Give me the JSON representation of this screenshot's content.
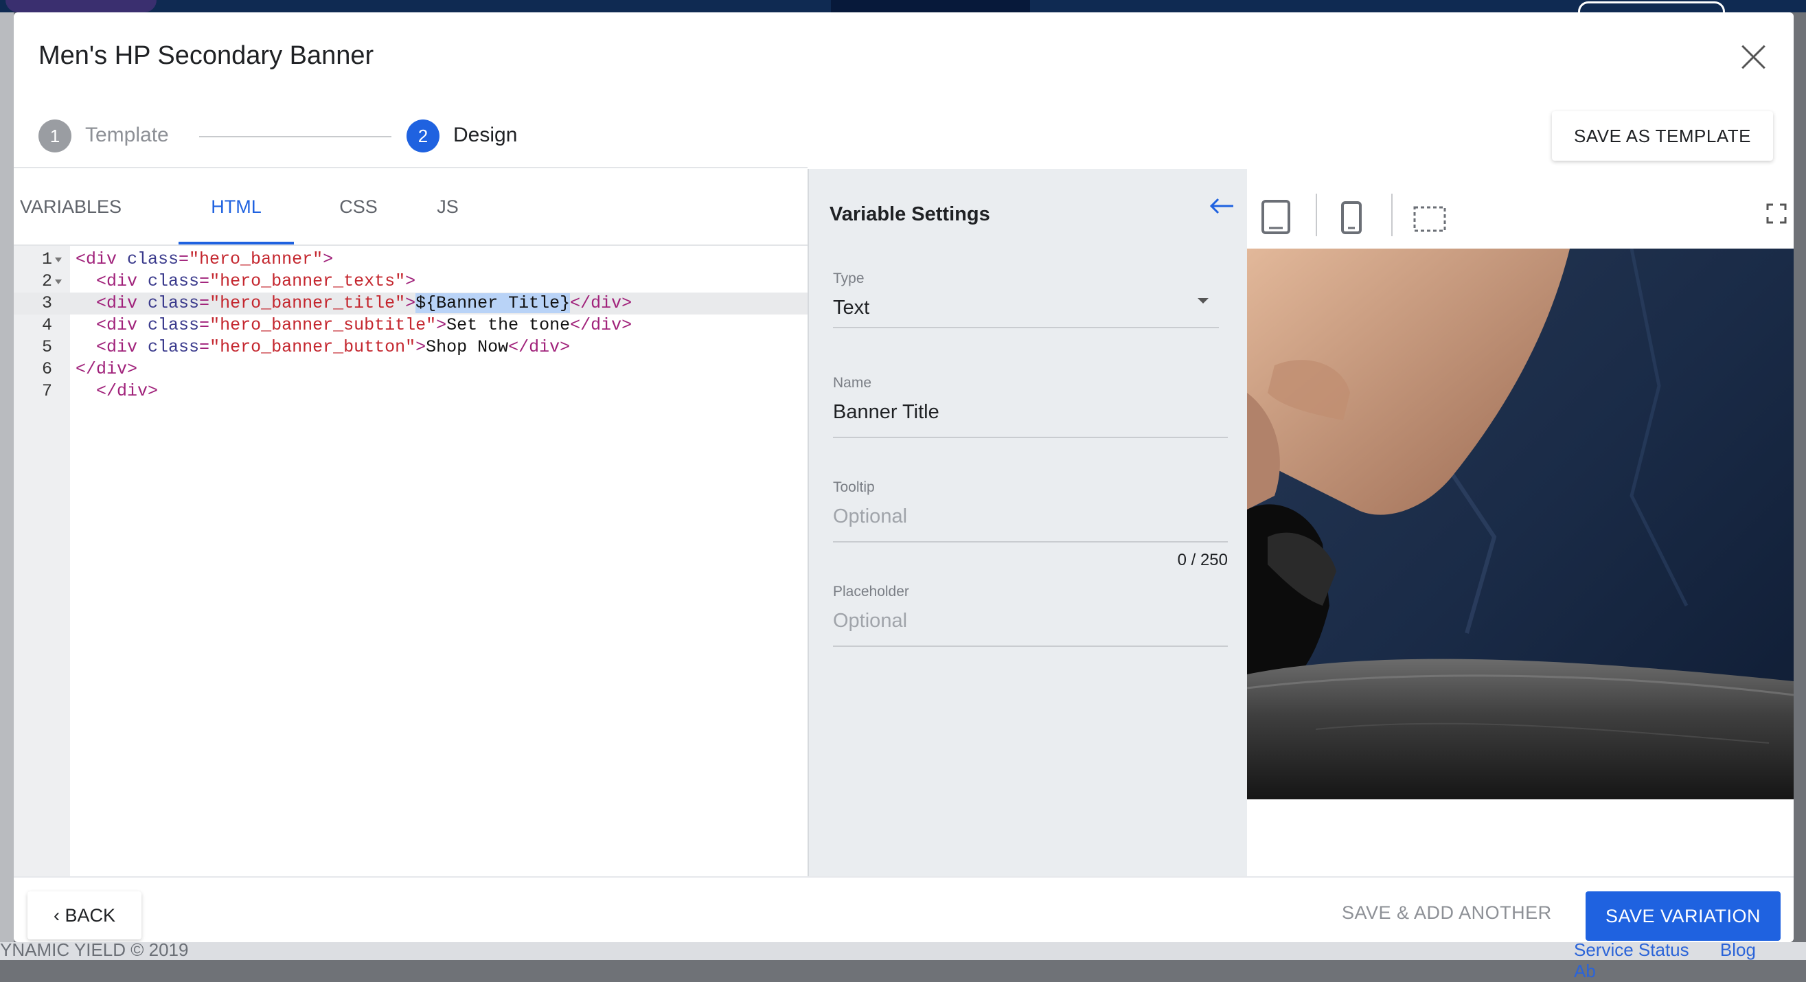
{
  "modal": {
    "title": "Men's HP Secondary Banner",
    "save_as_template": "SAVE AS TEMPLATE"
  },
  "stepper": {
    "steps": [
      {
        "number": "1",
        "label": "Template",
        "state": "done"
      },
      {
        "number": "2",
        "label": "Design",
        "state": "active"
      }
    ]
  },
  "editor_tabs": [
    {
      "label": "VARIABLES",
      "active": false
    },
    {
      "label": "HTML",
      "active": true
    },
    {
      "label": "CSS",
      "active": false
    },
    {
      "label": "JS",
      "active": false
    }
  ],
  "code_editor": {
    "active_line": 3,
    "lines": [
      {
        "n": "1",
        "text": "<div class=\"hero_banner\">"
      },
      {
        "n": "2",
        "text": "  <div class=\"hero_banner_texts\">"
      },
      {
        "n": "3",
        "text": "  <div class=\"hero_banner_title\">${Banner Title}</div>"
      },
      {
        "n": "4",
        "text": "  <div class=\"hero_banner_subtitle\">Set the tone</div>"
      },
      {
        "n": "5",
        "text": "  <div class=\"hero_banner_button\">Shop Now</div>"
      },
      {
        "n": "6",
        "text": "</div>"
      },
      {
        "n": "7",
        "text": "  </div>"
      }
    ],
    "selected_text": "${Banner Title}"
  },
  "variable_settings": {
    "title": "Variable Settings",
    "type": {
      "label": "Type",
      "value": "Text"
    },
    "name": {
      "label": "Name",
      "value": "Banner Title"
    },
    "tooltip": {
      "label": "Tooltip",
      "placeholder": "Optional",
      "counter": "0 / 250"
    },
    "placeholder": {
      "label": "Placeholder",
      "placeholder": "Optional"
    }
  },
  "preview": {
    "device_icons": [
      "tablet-icon",
      "mobile-icon",
      "selection-frame-icon"
    ],
    "fullscreen_icon": "fullscreen-icon"
  },
  "footer_actions": {
    "back": "BACK",
    "save_add_another": "SAVE & ADD ANOTHER",
    "save_variation": "SAVE VARIATION"
  },
  "background_page": {
    "copyright": "YNAMIC YIELD  ©  2019",
    "links": [
      "Service Status",
      "Blog",
      "Ab"
    ]
  },
  "colors": {
    "accent": "#1f62e0",
    "panel_bg": "#eaedf0"
  }
}
